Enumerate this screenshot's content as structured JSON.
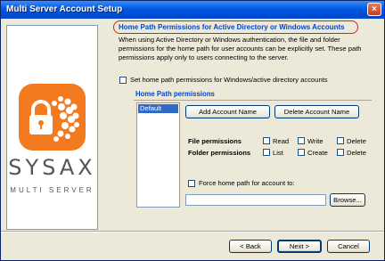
{
  "window": {
    "title": "Multi Server Account Setup",
    "close_label": "×"
  },
  "logo": {
    "brand": "SYSAX",
    "subtitle": "MULTI SERVER"
  },
  "section": {
    "heading": "Home Path Permissions for Active Directory or Windows Accounts",
    "description": "When using Active Directory or Windows authentication, the file and folder permissions for the home path for user accounts can be explicitly set. These path permissions apply only to users connecting to the server."
  },
  "set_home_path": {
    "label": "Set home path permissions for Windows/active directory accounts",
    "checked": false
  },
  "group": {
    "title": "Home Path permissions",
    "accounts": [
      "Default"
    ],
    "selected_account": "Default",
    "add_button": "Add Account Name",
    "delete_button": "Delete Account Name",
    "file_permissions_label": "File permissions",
    "folder_permissions_label": "Folder permissions",
    "file_options": [
      "Read",
      "Write",
      "Delete"
    ],
    "folder_options": [
      "List",
      "Create",
      "Delete"
    ],
    "force_label": "Force home path for account to:",
    "force_checked": false,
    "path_value": "",
    "browse_button": "Browse..."
  },
  "footer": {
    "back_button": "< Back",
    "next_button": "Next >",
    "cancel_button": "Cancel"
  },
  "colors": {
    "accent": "#0046d5",
    "brand": "#f47a20",
    "highlight_ring": "#d42020",
    "titlebar": "#0058e6"
  }
}
